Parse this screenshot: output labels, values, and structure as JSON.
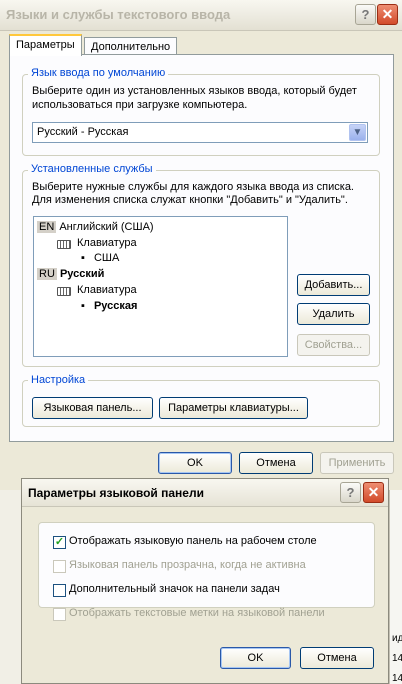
{
  "main_window": {
    "title": "Языки и службы текстового ввода",
    "tabs": [
      {
        "label": "Параметры",
        "active": true
      },
      {
        "label": "Дополнительно",
        "active": false
      }
    ],
    "default_language": {
      "title": "Язык ввода по умолчанию",
      "description_line1": "Выберите один из установленных языков ввода, который будет",
      "description_line2": "использоваться при загрузке компьютера.",
      "selected": "Русский - Русская"
    },
    "installed_services": {
      "title": "Установленные службы",
      "description_line1": "Выберите нужные службы для каждого языка ввода из списка.",
      "description_line2": "Для изменения списка служат кнопки \"Добавить\" и \"Удалить\".",
      "tree": [
        {
          "code": "EN",
          "language": "Английский (США)",
          "group": "Клавиатура",
          "layout": "США"
        },
        {
          "code": "RU",
          "language": "Русский",
          "group": "Клавиатура",
          "layout": "Русская"
        }
      ],
      "add_button": "Добавить...",
      "remove_button": "Удалить",
      "properties_button": "Свойства..."
    },
    "settings": {
      "title": "Настройка",
      "language_bar_button": "Языковая панель...",
      "key_settings_button": "Параметры клавиатуры..."
    },
    "ok_button": "OK",
    "cancel_button": "Отмена",
    "apply_button": "Применить"
  },
  "language_bar_dialog": {
    "title": "Параметры языковой панели",
    "options": [
      {
        "label": "Отображать языковую панель на рабочем столе",
        "checked": true,
        "enabled": true
      },
      {
        "label": "Языковая панель прозрачна, когда не активна",
        "checked": false,
        "enabled": false
      },
      {
        "label": "Дополнительный значок на панели задач",
        "checked": false,
        "enabled": true
      },
      {
        "label": "Отображать текстовые метки на языковой панели",
        "checked": false,
        "enabled": false
      }
    ],
    "ok_button": "OK",
    "cancel_button": "Отмена"
  },
  "background_edge": {
    "right_text_1": "ид",
    "right_text_2": "14",
    "right_text_3": "14"
  },
  "icons": {
    "help": "question-mark",
    "close": "x-cross",
    "dropdown": "chevron-down",
    "keyboard": "keyboard",
    "checkbox_check": "checkmark"
  },
  "colors": {
    "window_bg": "#ece9d8",
    "group_title": "#0046d5",
    "close_button": "#d24a2a",
    "active_tab_accent": "#ffc83c"
  }
}
